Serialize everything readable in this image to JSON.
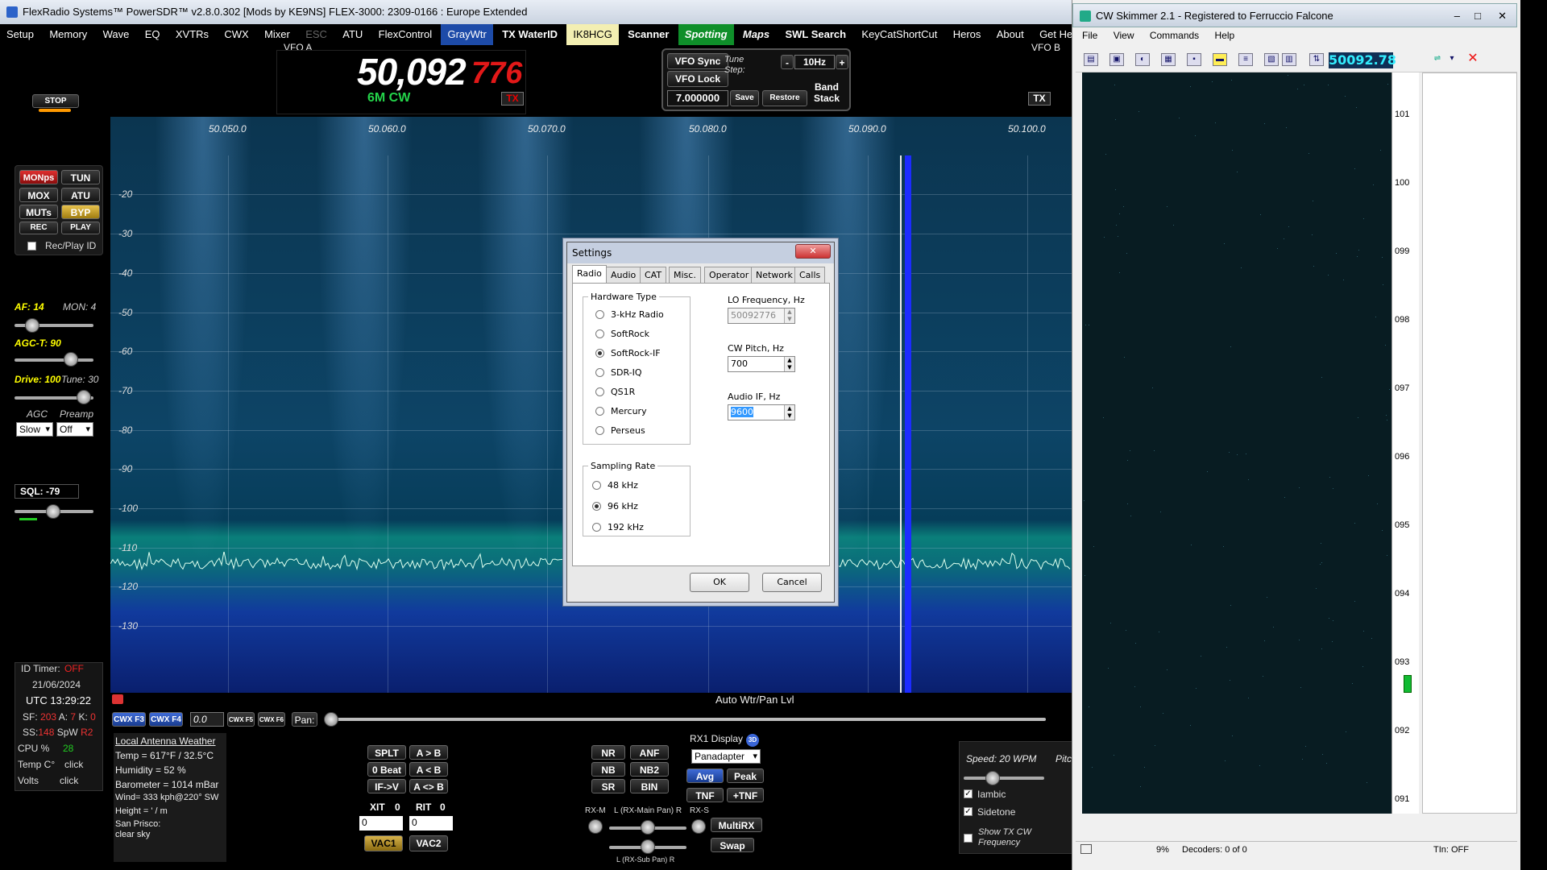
{
  "psdr": {
    "title": "FlexRadio Systems™  PowerSDR™  v2.8.0.302   [Mods by KE9NS]   FLEX-3000: 2309-0166 : Europe Extended",
    "menu": [
      "Setup",
      "Memory",
      "Wave",
      "EQ",
      "XVTRs",
      "CWX",
      "Mixer",
      "ESC",
      "ATU",
      "FlexControl",
      "GrayWtr",
      "TX WaterID",
      "IK8HCG",
      "Scanner",
      "Spotting",
      "Maps",
      "SWL Search",
      "KeyCatShortCut",
      "Heros",
      "About",
      "Get Help"
    ],
    "vfo_a_label": "VFO A",
    "vfo_b_label": "VFO B",
    "freq_main": "50,092",
    "freq_sub": "776",
    "mode": "6M CW",
    "tx_label": "TX",
    "stop_label": "STOP",
    "vfo_sync": "VFO Sync",
    "vfo_lock": "VFO Lock",
    "tune_step_label": "Tune\nStep:",
    "tune_step_value": "10Hz",
    "tune_minus": "-",
    "tune_plus": "+",
    "vfo_b_freq": "7.000000",
    "save": "Save",
    "restore": "Restore",
    "band_stack": "Band\nStack",
    "buttons": {
      "monps": "MONps",
      "tun": "TUN",
      "mox": "MOX",
      "atu": "ATU",
      "muts": "MUTs",
      "byp": "BYP",
      "rec": "REC",
      "play": "PLAY",
      "rec_play_id": "Rec/Play ID"
    },
    "af_label": "AF: 14",
    "mon_label": "MON: 4",
    "agct_label": "AGC-T:  90",
    "drive_label": "Drive: 100",
    "tune_label": "Tune: 30",
    "agc_label": "AGC",
    "preamp_label": "Preamp",
    "agc_value": "Slow",
    "preamp_value": "Off",
    "sql_label": "SQL: -79",
    "id_timer": "ID Timer:",
    "id_timer_val": "OFF",
    "date": "21/06/2024",
    "utc": "UTC  13:29:22",
    "sf_line_sf": "SF:",
    "sf_val": "203",
    "a_lbl": "A:",
    "a_val": "7",
    "k_lbl": "K:",
    "k_val": "0",
    "ss_lbl": "SS:",
    "ss_val": "148",
    "spw_lbl": "SpW",
    "spw_val": "R2",
    "cpu_lbl": "CPU %",
    "cpu_val": "28",
    "temp_lbl": "Temp C°",
    "temp_val": "click",
    "volts_lbl": "Volts",
    "volts_val": "click",
    "cwx_f3": "CWX F3",
    "cwx_f4": "CWX F4",
    "cwx_num": "0.0",
    "cwx_f5": "CWX F5",
    "cwx_f6": "CWX F6",
    "pan_label": "Pan:",
    "auto_wtr": "Auto Wtr/Pan Lvl",
    "weather_title": "Local Antenna Weather",
    "weather": [
      "Temp = 617°F / 32.5°C",
      "Humidity = 52 %",
      "Barometer = 1014 mBar",
      "Wind= 333 kph@220° SW",
      "Height = ' / m",
      "San Prisco:",
      "clear sky"
    ],
    "splt": "SPLT",
    "atob": "A > B",
    "zerobeat": "0 Beat",
    "atob2": "A < B",
    "ifv": "IF->V",
    "aswap": "A <> B",
    "xit": "XIT",
    "xit_val": "0",
    "rit": "RIT",
    "rit_val": "0",
    "xit_num": "0",
    "rit_num": "0",
    "vac1": "VAC1",
    "vac2": "VAC2",
    "nr": "NR",
    "anf": "ANF",
    "nb": "NB",
    "nb2": "NB2",
    "sr": "SR",
    "bin": "BIN",
    "rx1_display": "RX1 Display",
    "threed": "3D",
    "display_mode": "Panadapter",
    "avg": "Avg",
    "peak": "Peak",
    "tnf": "TNF",
    "ptnf": "+TNF",
    "rxm": "RX-M",
    "rxs": "RX-S",
    "main_pan": "L (RX-Main Pan) R",
    "sub_pan": "L (RX-Sub Pan) R",
    "multirx": "MultiRX",
    "swap": "Swap",
    "speed": "Speed:  20 WPM",
    "pitch": "Pitc",
    "iambic": "Iambic",
    "sidetone": "Sidetone",
    "show_tx": "Show TX CW\nFrequency",
    "freq_ticks": [
      "50.050.0",
      "50.060.0",
      "50.070.0",
      "50.080.0",
      "50.090.0",
      "50.100.0"
    ],
    "db_ticks": [
      "-20",
      "-30",
      "-40",
      "-50",
      "-60",
      "-70",
      "-80",
      "-90",
      "-100",
      "-110",
      "-120",
      "-130"
    ]
  },
  "dialog": {
    "title": "Settings",
    "tabs": [
      "Radio",
      "Audio",
      "CAT",
      "Misc.",
      "Operator",
      "Network",
      "Calls"
    ],
    "hw_legend": "Hardware Type",
    "hw_options": [
      "3-kHz Radio",
      "SoftRock",
      "SoftRock-IF",
      "SDR-IQ",
      "QS1R",
      "Mercury",
      "Perseus"
    ],
    "hw_selected": "SoftRock-IF",
    "sr_legend": "Sampling Rate",
    "sr_options": [
      "48 kHz",
      "96 kHz",
      "192 kHz"
    ],
    "sr_selected": "96 kHz",
    "lo_label": "LO Frequency, Hz",
    "lo_value": "50092776",
    "pitch_label": "CW Pitch, Hz",
    "pitch_value": "700",
    "audio_if_label": "Audio IF, Hz",
    "audio_if_value": "9600",
    "ok": "OK",
    "cancel": "Cancel"
  },
  "skimmer": {
    "title": "CW Skimmer 2.1 - Registered to Ferruccio Falcone",
    "menu": [
      "File",
      "View",
      "Commands",
      "Help"
    ],
    "freq": "50092.78",
    "scale": [
      "101",
      "100",
      "099",
      "098",
      "097",
      "096",
      "095",
      "094",
      "093",
      "092",
      "091"
    ],
    "status_pct": "9%",
    "status_dec": "Decoders: 0 of 0",
    "status_tin": "TIn: OFF"
  }
}
